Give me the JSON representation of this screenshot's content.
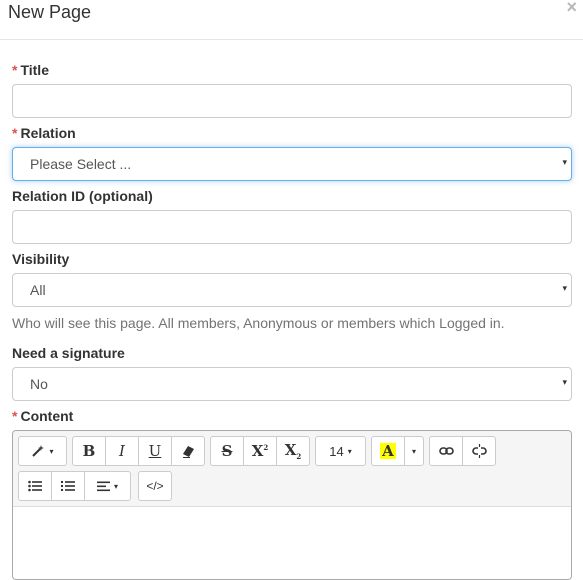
{
  "modal": {
    "title": "New Page",
    "close_glyph": "×"
  },
  "form": {
    "required_marker": "*",
    "title_label": "Title",
    "title_value": "",
    "relation_label": "Relation",
    "relation_selected": "Please Select ...",
    "relation_id_label": "Relation ID (optional)",
    "relation_id_value": "",
    "visibility_label": "Visibility",
    "visibility_selected": "All",
    "visibility_help": "Who will see this page. All members, Anonymous or members which Logged in.",
    "signature_label": "Need a signature",
    "signature_selected": "No",
    "content_label": "Content",
    "select_caret": "▾"
  },
  "toolbar": {
    "font_size": "14",
    "caret": "▾",
    "highlight_letter": "A",
    "highlight_color": "#ffff00",
    "icons": [
      "magic-icon",
      "bold-icon",
      "italic-icon",
      "underline-icon",
      "eraser-icon",
      "strikethrough-icon",
      "superscript-icon",
      "subscript-icon",
      "font-size-icon",
      "color-icon",
      "link-icon",
      "unlink-icon",
      "unordered-list-icon",
      "ordered-list-icon",
      "align-icon",
      "code-view-icon"
    ]
  },
  "colors": {
    "required": "#d9534f",
    "focus": "#66afe9",
    "help_text": "#737373"
  }
}
